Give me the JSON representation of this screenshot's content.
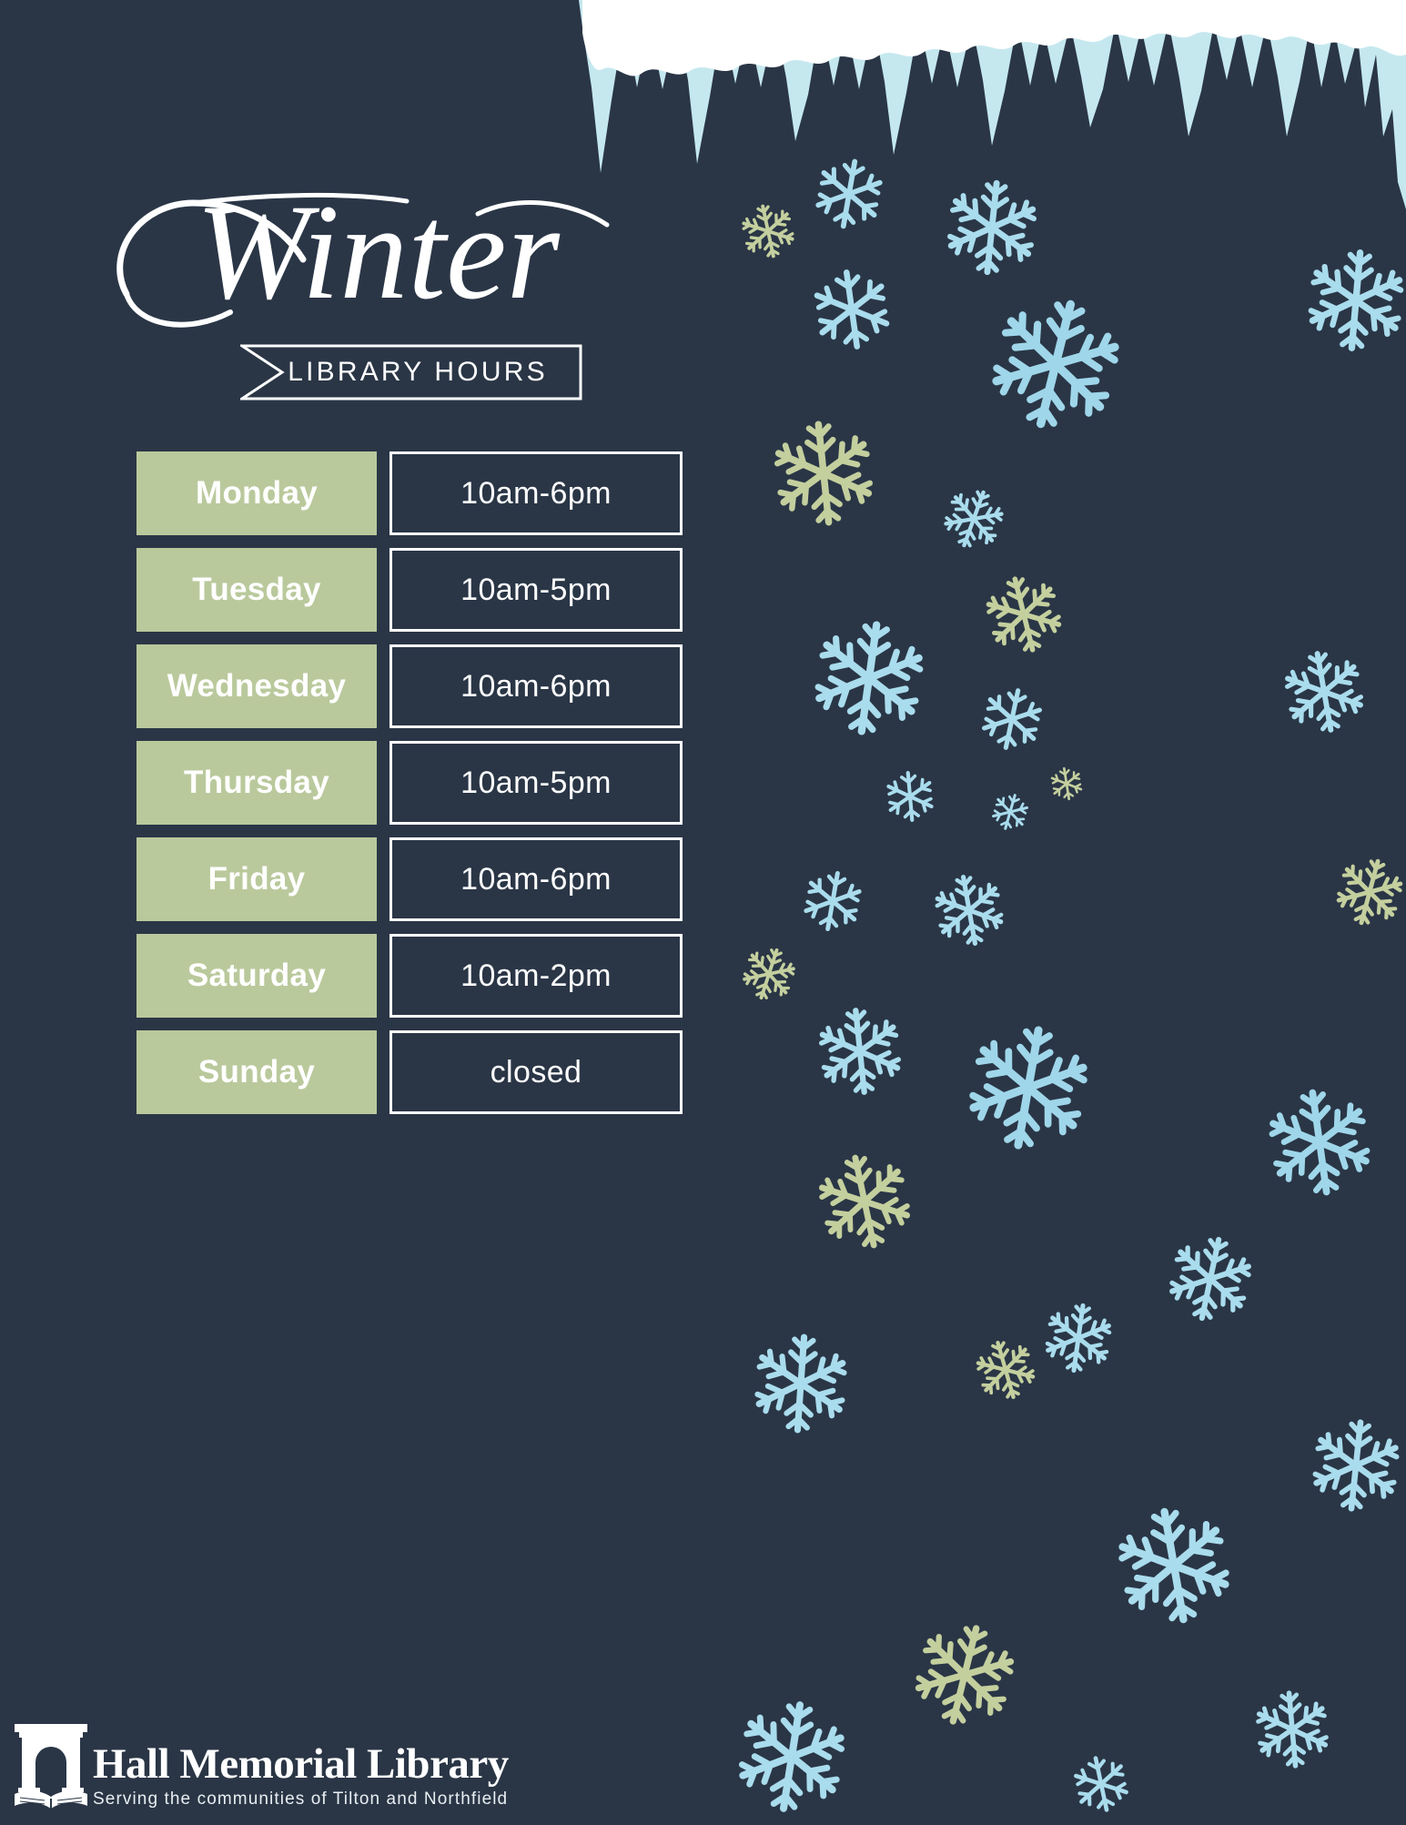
{
  "poster": {
    "title_script": "Winter",
    "banner_label": "LIBRARY HOURS",
    "background_color": "#2a3646",
    "day_cell_color": "#bac99c",
    "snow_white": "#ffffff",
    "icicle_blue": "#c5e8ef",
    "flake_blue": "#a9dced",
    "flake_blue_light": "#c9eaf2",
    "flake_green": "#c4cf9e"
  },
  "schedule": {
    "rows": [
      {
        "day": "Monday",
        "hours": "10am-6pm"
      },
      {
        "day": "Tuesday",
        "hours": "10am-5pm"
      },
      {
        "day": "Wednesday",
        "hours": "10am-6pm"
      },
      {
        "day": "Thursday",
        "hours": "10am-5pm"
      },
      {
        "day": "Friday",
        "hours": "10am-6pm"
      },
      {
        "day": "Saturday",
        "hours": "10am-2pm"
      },
      {
        "day": "Sunday",
        "hours": "closed"
      }
    ]
  },
  "footer": {
    "library_name": "Hall Memorial Library",
    "tagline": "Serving the communities of Tilton and Northfield",
    "logo_icon": "library-archway-book-icon"
  }
}
